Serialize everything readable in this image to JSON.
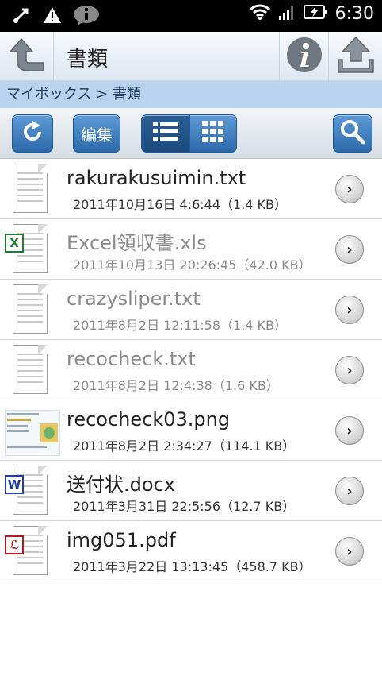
{
  "status_bar": {
    "time": "6:30"
  },
  "header": {
    "title": "書類"
  },
  "breadcrumb": {
    "path": "マイボックス > 書類"
  },
  "toolbar": {
    "edit_label": "編集"
  },
  "files": [
    {
      "name": "rakurakusuimin.txt",
      "meta": "2011年10月16日 4:6:44（1.4 KB）",
      "type": "txt",
      "dimmed": false
    },
    {
      "name": "Excel領収書.xls",
      "meta": "2011年10月13日 20:26:45（42.0 KB）",
      "type": "xls",
      "dimmed": true
    },
    {
      "name": "crazysliper.txt",
      "meta": "2011年8月2日 12:11:58（1.4 KB）",
      "type": "txt",
      "dimmed": true
    },
    {
      "name": "recocheck.txt",
      "meta": "2011年8月2日 12:4:38（1.6 KB）",
      "type": "txt",
      "dimmed": true
    },
    {
      "name": "recocheck03.png",
      "meta": "2011年8月2日 2:34:27（114.1 KB）",
      "type": "png",
      "dimmed": false
    },
    {
      "name": "送付状.docx",
      "meta": "2011年3月31日 22:5:56（12.7 KB）",
      "type": "docx",
      "dimmed": false
    },
    {
      "name": "img051.pdf",
      "meta": "2011年3月22日 13:13:45（458.7 KB）",
      "type": "pdf",
      "dimmed": false
    }
  ],
  "icons": {
    "back": "back-arrow-icon",
    "info": "info-icon",
    "upload": "upload-icon",
    "refresh": "refresh-icon",
    "list_view": "list-view-icon",
    "grid_view": "grid-view-icon",
    "search": "search-icon",
    "row_arrow": "chevron-right-icon"
  },
  "colors": {
    "breadcrumb_bg": "#b9d3ee",
    "button_blue": "#2c6aac",
    "selected_toggle": "#1c4a7c"
  }
}
